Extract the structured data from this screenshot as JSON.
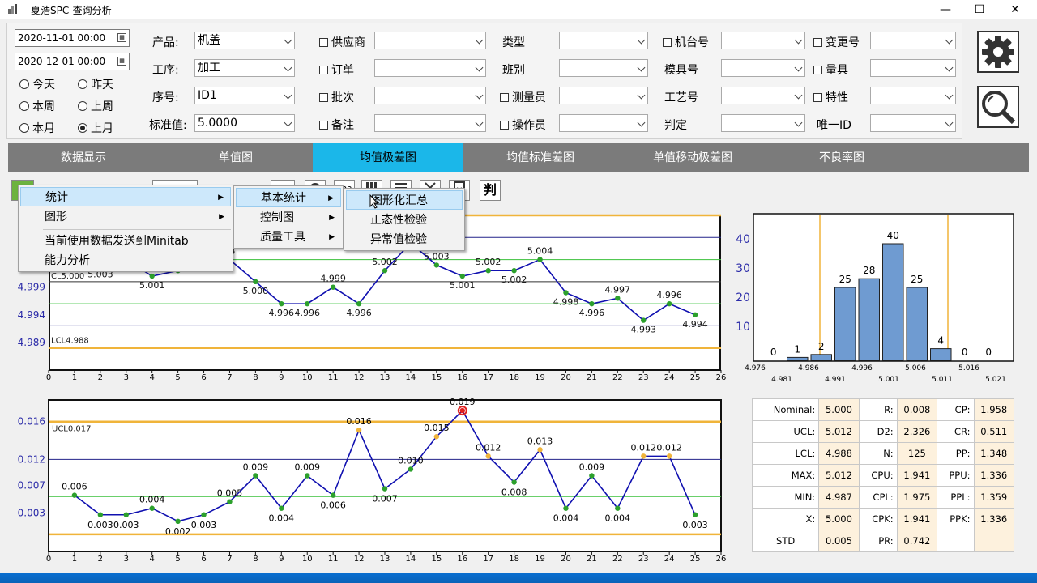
{
  "window": {
    "title": "夏浩SPC-查询分析",
    "minimize": "—",
    "maximize": "☐",
    "close": "✕"
  },
  "filters": {
    "start_date": "2020-11-01 00:00",
    "end_date": "2020-12-01 00:00",
    "radios": [
      {
        "label": "今天",
        "checked": false
      },
      {
        "label": "昨天",
        "checked": false
      },
      {
        "label": "本周",
        "checked": false
      },
      {
        "label": "上周",
        "checked": false
      },
      {
        "label": "本月",
        "checked": false
      },
      {
        "label": "上月",
        "checked": true
      }
    ],
    "product_label": "产品:",
    "product_value": "机盖",
    "process_label": "工序:",
    "process_value": "加工",
    "seq_label": "序号:",
    "seq_value": "ID1",
    "std_label": "标准值:",
    "std_value": "5.0000",
    "col2": [
      "供应商",
      "订单",
      "批次",
      "备注"
    ],
    "col3_labels": [
      "类型",
      "班别",
      "测量员",
      "操作员"
    ],
    "col4_labels": [
      "机台号",
      "模具号",
      "工艺号",
      "判定"
    ],
    "col5_labels": [
      "变更号",
      "量具",
      "特性",
      "唯一ID"
    ]
  },
  "tabs": [
    "数据显示",
    "单值图",
    "均值极差图",
    "均值标准差图",
    "单值移动极差图",
    "不良率图"
  ],
  "active_tab": 2,
  "toolbar": {
    "judge_label": "判",
    "num_label": "5",
    "abc_label": "123"
  },
  "context_menu": {
    "main": [
      "统计",
      "图形",
      "当前使用数据发送到Minitab",
      "能力分析"
    ],
    "sub1": [
      "基本统计",
      "控制图",
      "质量工具"
    ],
    "sub2": [
      "图形化汇总",
      "正态性检验",
      "异常值检验"
    ]
  },
  "xbar_chart": {
    "x": [
      1,
      2,
      3,
      4,
      5,
      6,
      7,
      8,
      9,
      10,
      11,
      12,
      13,
      14,
      15,
      16,
      17,
      18,
      19,
      20,
      21,
      22,
      23,
      24,
      25
    ],
    "y": [
      5.004,
      5.003,
      5.004,
      5.001,
      5.002,
      5.004,
      5.004,
      5.0,
      4.996,
      4.996,
      4.999,
      4.996,
      5.002,
      5.007,
      5.003,
      5.001,
      5.002,
      5.002,
      5.004,
      4.998,
      4.996,
      4.997,
      4.993,
      4.996,
      4.994
    ],
    "labels": [
      "",
      "5.003",
      "",
      "5.001",
      "5.002",
      "",
      "04",
      "5.000",
      "4.996",
      "4.996",
      "4.999",
      "4.996",
      "5.002",
      "",
      "5.003",
      "5.001",
      "5.002",
      "5.002",
      "5.004",
      "4.998",
      "4.996",
      "4.997",
      "4.993",
      "4.996",
      "4.994"
    ],
    "cl_label": "CL5.000",
    "lcl_label": "LCL4.988",
    "y_ticks": [
      "4.999",
      "4.994",
      "4.989"
    ],
    "x_ticks": [
      "0",
      "1",
      "2",
      "3",
      "4",
      "5",
      "6",
      "7",
      "8",
      "9",
      "10",
      "11",
      "12",
      "13",
      "14",
      "15",
      "16",
      "17",
      "18",
      "19",
      "20",
      "21",
      "22",
      "23",
      "24",
      "25",
      "26"
    ],
    "ylim": [
      4.984,
      5.012
    ]
  },
  "range_chart": {
    "y": [
      0.006,
      0.003,
      0.003,
      0.004,
      0.002,
      0.003,
      0.005,
      0.009,
      0.004,
      0.009,
      0.006,
      0.016,
      0.007,
      0.01,
      0.015,
      0.019,
      0.012,
      0.008,
      0.013,
      0.004,
      0.009,
      0.004,
      0.012,
      0.012,
      0.003
    ],
    "labels": [
      "0.006",
      "0.003",
      "0.003",
      "0.004",
      "0.002",
      "0.003",
      "0.005",
      "0.009",
      "0.004",
      "0.009",
      "0.006",
      "0.016",
      "0.007",
      "0.010",
      "0.015",
      "0.019",
      "0.012",
      "0.008",
      "0.013",
      "0.004",
      "0.009",
      "0.004",
      "0.012",
      "0.012",
      "0.003"
    ],
    "ucl_label": "UCL0.017",
    "y_ticks": [
      "0.016",
      "0.012",
      "0.007",
      "0.003"
    ],
    "ylim": [
      -0.0025,
      0.0205
    ]
  },
  "histogram": {
    "counts": [
      0,
      1,
      2,
      25,
      28,
      40,
      25,
      4,
      0,
      0
    ],
    "count_labels": [
      "0",
      "1",
      "2",
      "25",
      "28",
      "40",
      "25",
      "4",
      "0",
      "0"
    ],
    "y_ticks": [
      "40",
      "30",
      "20",
      "10"
    ],
    "x_ticks_top": [
      "4.976",
      "4.986",
      "4.996",
      "5.006",
      "5.016"
    ],
    "x_ticks_bottom": [
      "4.981",
      "4.991",
      "5.001",
      "5.011",
      "5.021"
    ]
  },
  "stats": [
    [
      "Nominal:",
      "5.000",
      "R:",
      "0.008",
      "CP:",
      "1.958"
    ],
    [
      "UCL:",
      "5.012",
      "D2:",
      "2.326",
      "CR:",
      "0.511"
    ],
    [
      "LCL:",
      "4.988",
      "N:",
      "125",
      "PP:",
      "1.348"
    ],
    [
      "MAX:",
      "5.012",
      "CPU:",
      "1.941",
      "PPU:",
      "1.336"
    ],
    [
      "MIN:",
      "4.987",
      "CPL:",
      "1.975",
      "PPL:",
      "1.359"
    ],
    [
      "X:",
      "5.000",
      "CPK:",
      "1.941",
      "PPK:",
      "1.336"
    ],
    [
      "STD",
      "0.005",
      "PR:",
      "0.742",
      "",
      ""
    ]
  ],
  "colors": {
    "accent_tab": "#1bb7e9",
    "series": "#1010b0",
    "limit": "#f0b43a",
    "green": "#2ca02c",
    "bar": "#6f9bd1"
  }
}
